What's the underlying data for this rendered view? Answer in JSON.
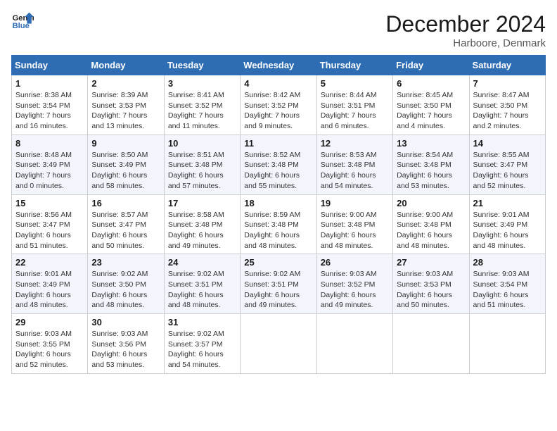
{
  "header": {
    "logo_line1": "General",
    "logo_line2": "Blue",
    "month": "December 2024",
    "location": "Harboore, Denmark"
  },
  "weekdays": [
    "Sunday",
    "Monday",
    "Tuesday",
    "Wednesday",
    "Thursday",
    "Friday",
    "Saturday"
  ],
  "weeks": [
    [
      {
        "day": "1",
        "info": "Sunrise: 8:38 AM\nSunset: 3:54 PM\nDaylight: 7 hours\nand 16 minutes."
      },
      {
        "day": "2",
        "info": "Sunrise: 8:39 AM\nSunset: 3:53 PM\nDaylight: 7 hours\nand 13 minutes."
      },
      {
        "day": "3",
        "info": "Sunrise: 8:41 AM\nSunset: 3:52 PM\nDaylight: 7 hours\nand 11 minutes."
      },
      {
        "day": "4",
        "info": "Sunrise: 8:42 AM\nSunset: 3:52 PM\nDaylight: 7 hours\nand 9 minutes."
      },
      {
        "day": "5",
        "info": "Sunrise: 8:44 AM\nSunset: 3:51 PM\nDaylight: 7 hours\nand 6 minutes."
      },
      {
        "day": "6",
        "info": "Sunrise: 8:45 AM\nSunset: 3:50 PM\nDaylight: 7 hours\nand 4 minutes."
      },
      {
        "day": "7",
        "info": "Sunrise: 8:47 AM\nSunset: 3:50 PM\nDaylight: 7 hours\nand 2 minutes."
      }
    ],
    [
      {
        "day": "8",
        "info": "Sunrise: 8:48 AM\nSunset: 3:49 PM\nDaylight: 7 hours\nand 0 minutes."
      },
      {
        "day": "9",
        "info": "Sunrise: 8:50 AM\nSunset: 3:49 PM\nDaylight: 6 hours\nand 58 minutes."
      },
      {
        "day": "10",
        "info": "Sunrise: 8:51 AM\nSunset: 3:48 PM\nDaylight: 6 hours\nand 57 minutes."
      },
      {
        "day": "11",
        "info": "Sunrise: 8:52 AM\nSunset: 3:48 PM\nDaylight: 6 hours\nand 55 minutes."
      },
      {
        "day": "12",
        "info": "Sunrise: 8:53 AM\nSunset: 3:48 PM\nDaylight: 6 hours\nand 54 minutes."
      },
      {
        "day": "13",
        "info": "Sunrise: 8:54 AM\nSunset: 3:48 PM\nDaylight: 6 hours\nand 53 minutes."
      },
      {
        "day": "14",
        "info": "Sunrise: 8:55 AM\nSunset: 3:47 PM\nDaylight: 6 hours\nand 52 minutes."
      }
    ],
    [
      {
        "day": "15",
        "info": "Sunrise: 8:56 AM\nSunset: 3:47 PM\nDaylight: 6 hours\nand 51 minutes."
      },
      {
        "day": "16",
        "info": "Sunrise: 8:57 AM\nSunset: 3:47 PM\nDaylight: 6 hours\nand 50 minutes."
      },
      {
        "day": "17",
        "info": "Sunrise: 8:58 AM\nSunset: 3:48 PM\nDaylight: 6 hours\nand 49 minutes."
      },
      {
        "day": "18",
        "info": "Sunrise: 8:59 AM\nSunset: 3:48 PM\nDaylight: 6 hours\nand 48 minutes."
      },
      {
        "day": "19",
        "info": "Sunrise: 9:00 AM\nSunset: 3:48 PM\nDaylight: 6 hours\nand 48 minutes."
      },
      {
        "day": "20",
        "info": "Sunrise: 9:00 AM\nSunset: 3:48 PM\nDaylight: 6 hours\nand 48 minutes."
      },
      {
        "day": "21",
        "info": "Sunrise: 9:01 AM\nSunset: 3:49 PM\nDaylight: 6 hours\nand 48 minutes."
      }
    ],
    [
      {
        "day": "22",
        "info": "Sunrise: 9:01 AM\nSunset: 3:49 PM\nDaylight: 6 hours\nand 48 minutes."
      },
      {
        "day": "23",
        "info": "Sunrise: 9:02 AM\nSunset: 3:50 PM\nDaylight: 6 hours\nand 48 minutes."
      },
      {
        "day": "24",
        "info": "Sunrise: 9:02 AM\nSunset: 3:51 PM\nDaylight: 6 hours\nand 48 minutes."
      },
      {
        "day": "25",
        "info": "Sunrise: 9:02 AM\nSunset: 3:51 PM\nDaylight: 6 hours\nand 49 minutes."
      },
      {
        "day": "26",
        "info": "Sunrise: 9:03 AM\nSunset: 3:52 PM\nDaylight: 6 hours\nand 49 minutes."
      },
      {
        "day": "27",
        "info": "Sunrise: 9:03 AM\nSunset: 3:53 PM\nDaylight: 6 hours\nand 50 minutes."
      },
      {
        "day": "28",
        "info": "Sunrise: 9:03 AM\nSunset: 3:54 PM\nDaylight: 6 hours\nand 51 minutes."
      }
    ],
    [
      {
        "day": "29",
        "info": "Sunrise: 9:03 AM\nSunset: 3:55 PM\nDaylight: 6 hours\nand 52 minutes."
      },
      {
        "day": "30",
        "info": "Sunrise: 9:03 AM\nSunset: 3:56 PM\nDaylight: 6 hours\nand 53 minutes."
      },
      {
        "day": "31",
        "info": "Sunrise: 9:02 AM\nSunset: 3:57 PM\nDaylight: 6 hours\nand 54 minutes."
      },
      null,
      null,
      null,
      null
    ]
  ]
}
